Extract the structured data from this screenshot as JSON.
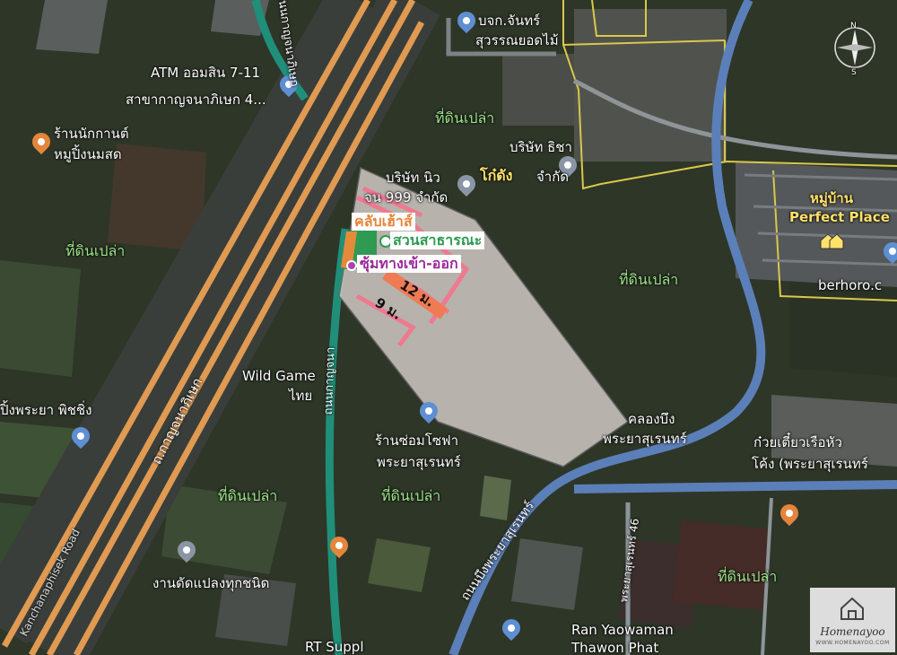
{
  "map": {
    "places": {
      "atm": "ATM ออมสิน 7-11",
      "atm_branch": "สาขากาญจนาภิเษก 4...",
      "noodle": "ร้านนักกานต์",
      "noodle2": "หมูปิ้งนมสด",
      "company_chan": "บจก.จันทร์",
      "company_chan2": "สุวรรณยอดไม้",
      "company_thicha": "บริษัท ธิชา",
      "company_thicha2": "จำกัด",
      "company_new": "บริษัท นิว",
      "company_new2": "จน 999 จำกัด",
      "kodung": "โก๋ดัง",
      "wild_game": "Wild Game",
      "wild_game2": "ไทย",
      "sofa": "ร้านซ่อมโซฟา",
      "sofa2": "พระยาสุเรนทร์",
      "ping": "ปิ้งพระยา พิชชิ่ง",
      "glass": "งานดัดแปลงทุกชนิด",
      "noodle_boat": "ก๋วยเตี๋ยวเรือหัว",
      "noodle_boat2": "โค้ง (พระยาสุเรนทร์",
      "ran": "Ran Yaowaman",
      "ran2": "Thawon Phat",
      "rt": "RT Suppl",
      "berhoro": "berhoro.c",
      "khlong_text": "คลองบึง",
      "khlong_text2": "พระยาสุเรนทร์"
    },
    "areas": {
      "a1": "ที่ดินเปล่า",
      "a2": "ที่ดินเปล่า",
      "a3": "ที่ดินเปล่า",
      "a4": "ที่ดินเปล่า",
      "a5": "ที่ดินเปล่า",
      "a6": "ที่ดินเปล่า"
    },
    "village": {
      "name": "หมู่บ้าน",
      "name2": "Perfect Place"
    },
    "roads": {
      "road_kanchana": "ถ.กาญจนาภิเษก",
      "road_left_en": "Kanchanaphisek Road",
      "road_lower": "ถนนบึงพระยาสุเรนทร์",
      "soi46": "พระยาสุเรนทร์ 46",
      "road_teal": "ถนนกาญจนาภิเษก",
      "road_mid": "ถนนกาญจนา"
    },
    "plot": {
      "clubhouse": "คลับเฮ้าส์",
      "park": "สวนสาธารณะ",
      "gate": "ซุ้มทางเข้า-ออก",
      "road12": "12 ม.",
      "road9": "9 ม."
    },
    "compass": {
      "n": "N",
      "s": "S"
    },
    "logo": {
      "name": "Homenayoo",
      "url": "WWW.HOMENAYOO.COM"
    },
    "colors": {
      "highway": "#e09a52",
      "teal_road": "#1f8f7a",
      "blue_road": "#5b7fb8",
      "plot_fill": "#cfc8c4",
      "plot_pink": "#f07890",
      "village_border": "#d9c84a",
      "road12": "#f07a52"
    }
  }
}
